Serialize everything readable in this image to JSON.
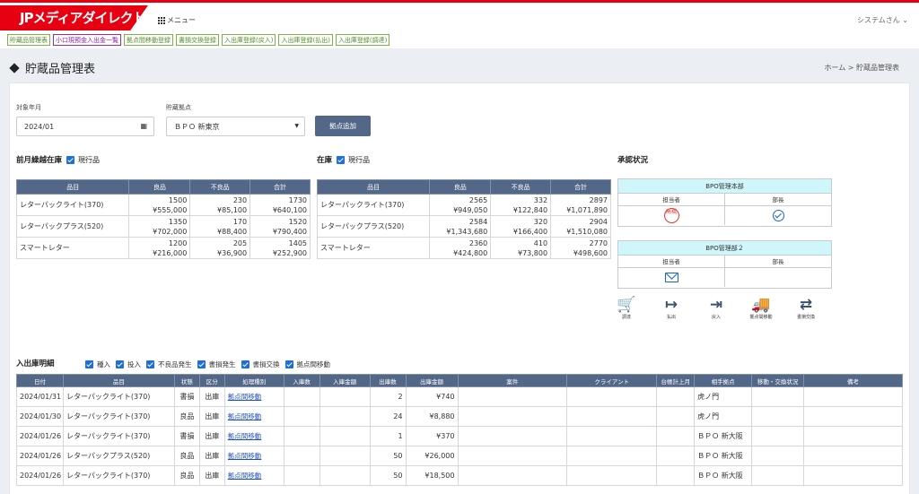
{
  "app": {
    "logo": "JPメディアダイレクト",
    "menu_label": "メニュー",
    "user_label": "システムさん ⌄"
  },
  "nav_tabs": [
    "貯蔵品管理表",
    "小口現預金入出金一覧",
    "拠点間移動登録",
    "書損交換登録",
    "入出庫登録(戻入)",
    "入出庫登録(払出)",
    "入出庫登録(調達)"
  ],
  "page": {
    "title": "貯蔵品管理表",
    "breadcrumb": "ホーム >  貯蔵品管理表"
  },
  "filter": {
    "month_label": "対象年月",
    "month_value": "2024/01",
    "site_label": "貯蔵拠点",
    "site_value": "ＢＰＯ 新東京",
    "add_button": "拠点追加"
  },
  "carryover": {
    "title": "前月繰越在庫",
    "check_label": "現行品",
    "headers": [
      "品目",
      "良品",
      "不良品",
      "合計"
    ],
    "rows": [
      {
        "item": "レターパックライト(370)",
        "good_qty": "1500",
        "good_amt": "¥555,000",
        "bad_qty": "230",
        "bad_amt": "¥85,100",
        "total_qty": "1730",
        "total_amt": "¥640,100"
      },
      {
        "item": "レターパックプラス(520)",
        "good_qty": "1350",
        "good_amt": "¥702,000",
        "bad_qty": "170",
        "bad_amt": "¥88,400",
        "total_qty": "1520",
        "total_amt": "¥790,400"
      },
      {
        "item": "スマートレター",
        "good_qty": "1200",
        "good_amt": "¥216,000",
        "bad_qty": "205",
        "bad_amt": "¥36,900",
        "total_qty": "1405",
        "total_amt": "¥252,900"
      }
    ]
  },
  "stock": {
    "title": "在庫",
    "check_label": "現行品",
    "headers": [
      "品目",
      "良品",
      "不良品",
      "合計"
    ],
    "rows": [
      {
        "item": "レターパックライト(370)",
        "good_qty": "2565",
        "good_amt": "¥949,050",
        "bad_qty": "332",
        "bad_amt": "¥122,840",
        "total_qty": "2897",
        "total_amt": "¥1,071,890"
      },
      {
        "item": "レターパックプラス(520)",
        "good_qty": "2584",
        "good_amt": "¥1,343,680",
        "bad_qty": "320",
        "bad_amt": "¥166,400",
        "total_qty": "2904",
        "total_amt": "¥1,510,080"
      },
      {
        "item": "スマートレター",
        "good_qty": "2360",
        "good_amt": "¥424,800",
        "bad_qty": "410",
        "bad_amt": "¥73,800",
        "total_qty": "2770",
        "total_amt": "¥498,600"
      }
    ]
  },
  "approval": {
    "title": "承認状況",
    "box1": {
      "dept": "BPO管理本部",
      "col1": "担当者",
      "col2": "部長",
      "stamp": "高橋"
    },
    "box2": {
      "dept": "BPO管理部２",
      "col1": "担当者",
      "col2": "部長"
    },
    "actions": [
      {
        "icon": "cart-icon",
        "glyph": "🛒",
        "label": "調達"
      },
      {
        "icon": "sign-out-icon",
        "glyph": "↦",
        "label": "払出"
      },
      {
        "icon": "sign-in-icon",
        "glyph": "⇥",
        "label": "戻入"
      },
      {
        "icon": "truck-icon",
        "glyph": "🚚",
        "label": "拠点間移動"
      },
      {
        "icon": "exchange-icon",
        "glyph": "⇄",
        "label": "書損交換"
      }
    ]
  },
  "ledger": {
    "title": "入出庫明細",
    "filters": [
      "種入",
      "投入",
      "不良品発生",
      "書損発生",
      "書損交換",
      "拠点間移動"
    ],
    "headers": [
      "日付",
      "品目",
      "状態",
      "区分",
      "処理種別",
      "入庫数",
      "入庫金額",
      "出庫数",
      "出庫金額",
      "案件",
      "クライアント",
      "台帳計上月",
      "相手拠点",
      "移動・交換状況",
      "備考"
    ],
    "rows": [
      {
        "date": "2024/01/31",
        "item": "レターパックライト(370)",
        "state": "書損",
        "kind": "出庫",
        "type": "拠点間移動",
        "out_qty": "2",
        "out_amt": "¥740",
        "partner": "虎ノ門"
      },
      {
        "date": "2024/01/30",
        "item": "レターパックライト(370)",
        "state": "良品",
        "kind": "出庫",
        "type": "拠点間移動",
        "out_qty": "24",
        "out_amt": "¥8,880",
        "partner": "虎ノ門"
      },
      {
        "date": "2024/01/26",
        "item": "レターパックライト(370)",
        "state": "書損",
        "kind": "出庫",
        "type": "拠点間移動",
        "out_qty": "1",
        "out_amt": "¥370",
        "partner": "ＢＰＯ 新大阪"
      },
      {
        "date": "2024/01/26",
        "item": "レターパックプラス(520)",
        "state": "良品",
        "kind": "出庫",
        "type": "拠点間移動",
        "out_qty": "50",
        "out_amt": "¥26,000",
        "partner": "ＢＰＯ 新大阪"
      },
      {
        "date": "2024/01/26",
        "item": "レターパックライト(370)",
        "state": "良品",
        "kind": "出庫",
        "type": "拠点間移動",
        "out_qty": "50",
        "out_amt": "¥18,500",
        "partner": "ＢＰＯ 新大阪"
      }
    ]
  }
}
